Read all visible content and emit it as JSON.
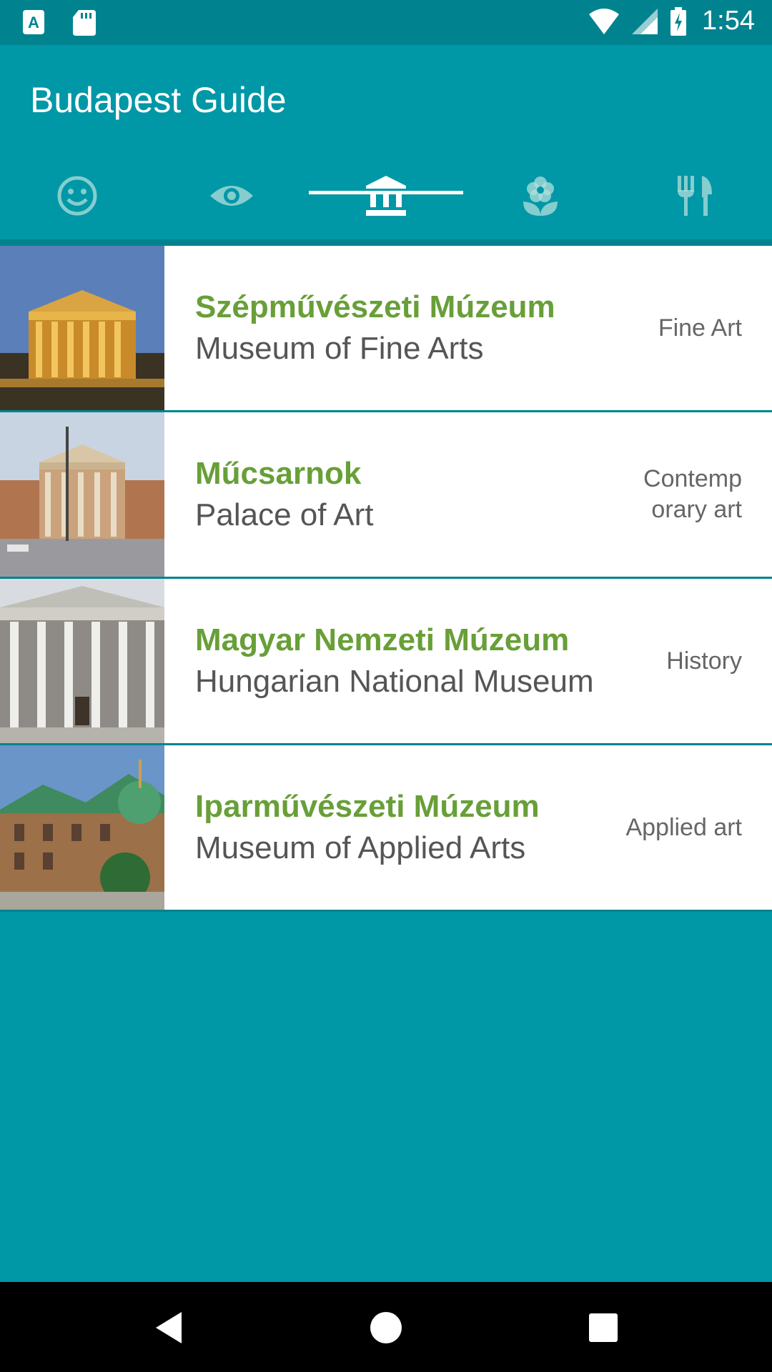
{
  "status_bar": {
    "time": "1:54",
    "icons": [
      "a-badge-icon",
      "sd-card-icon",
      "wifi-icon",
      "signal-icon",
      "battery-charging-icon"
    ]
  },
  "app_bar": {
    "title": "Budapest Guide"
  },
  "tabs": [
    {
      "icon": "smiley-icon",
      "selected": false
    },
    {
      "icon": "eye-icon",
      "selected": false
    },
    {
      "icon": "museum-icon",
      "selected": true
    },
    {
      "icon": "flower-icon",
      "selected": false
    },
    {
      "icon": "restaurant-icon",
      "selected": false
    }
  ],
  "museums": [
    {
      "name_hu": "Szépművészeti Múzeum",
      "name_en": "Museum of Fine Arts",
      "category": "Fine Art"
    },
    {
      "name_hu": "Műcsarnok",
      "name_en": "Palace of Art",
      "category": "Contemporary art"
    },
    {
      "name_hu": "Magyar Nemzeti Múzeum",
      "name_en": "Hungarian National Museum",
      "category": "History"
    },
    {
      "name_hu": "Iparművészeti Múzeum",
      "name_en": "Museum of Applied Arts",
      "category": "Applied art"
    }
  ],
  "colors": {
    "primary": "#0097a7",
    "primary_dark": "#00838f",
    "title_green": "#689f38",
    "subtitle_gray": "#555555"
  },
  "nav_bar": {
    "icons": [
      "back-icon",
      "home-icon",
      "recents-icon"
    ]
  }
}
